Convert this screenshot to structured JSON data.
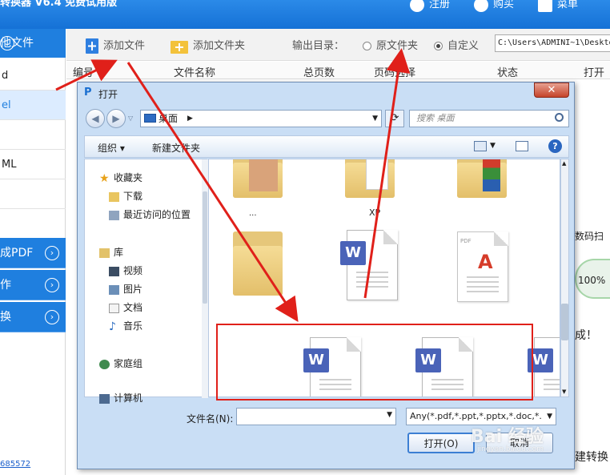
{
  "app": {
    "title": "转换器 V6.4 免费试用版",
    "actions": [
      "注册",
      "购买",
      "菜单"
    ]
  },
  "sidebar": {
    "header": "他文件",
    "items": [
      "d",
      "el",
      "",
      "ML",
      ""
    ],
    "active_index": 1,
    "blue_items": [
      "成PDF",
      "作",
      "换"
    ],
    "link": "685572"
  },
  "toolbar": {
    "add_file": "添加文件",
    "add_folder": "添加文件夹",
    "output_label": "输出目录：",
    "opt_source": "原文件夹",
    "opt_custom": "自定义",
    "selected_option": "自定义",
    "output_path": "C:\\Users\\ADMINI~1\\Deskto"
  },
  "columns": [
    "编号",
    "文件名称",
    "总页数",
    "页码选择",
    "状态",
    "打开"
  ],
  "right_panel": {
    "label1": "数码扫",
    "progress": "100%",
    "label2": "成！",
    "label3": "建转换"
  },
  "dialog": {
    "title": "打开",
    "close": "✕",
    "address": "桌面",
    "search_placeholder": "搜索 桌面",
    "organize": "组织 ▾",
    "new_folder": "新建文件夹",
    "nav": {
      "favorites": "收藏夹",
      "downloads": "下载",
      "recent": "最近访问的位置",
      "library": "库",
      "videos": "视频",
      "pictures": "图片",
      "documents": "文档",
      "music": "音乐",
      "homegroup": "家庭组",
      "computer": "计算机"
    },
    "files": [
      {
        "type": "folder",
        "label": "..."
      },
      {
        "type": "folder",
        "label": "XP"
      },
      {
        "type": "folder",
        "label": ""
      },
      {
        "type": "folder",
        "label": ""
      },
      {
        "type": "word",
        "label": ""
      },
      {
        "type": "pdf",
        "label": ""
      },
      {
        "type": "word",
        "label": ""
      },
      {
        "type": "word",
        "label": ""
      },
      {
        "type": "word",
        "label": ""
      }
    ],
    "filename_label": "文件名(N):",
    "filename_value": "",
    "filter": "Any(*.pdf,*.ppt,*.pptx,*.doc,*.",
    "open_button": "打开(O)",
    "cancel_button": "取消"
  },
  "watermark": {
    "text": "Bai 经验",
    "sub": "jingyan.baidu.com"
  },
  "colors": {
    "title_blue": "#1571d6",
    "accent_blue": "#1f7fdf",
    "annotation_red": "#e0201a"
  }
}
